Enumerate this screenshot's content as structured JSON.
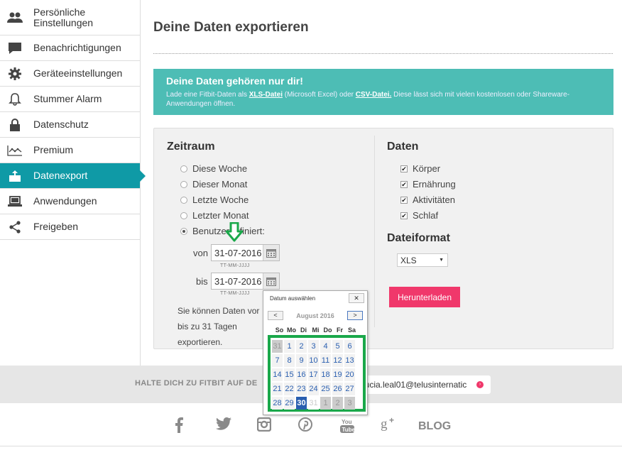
{
  "sidebar": {
    "items": [
      {
        "label": "Persönliche Einstellungen",
        "icon": "users-icon"
      },
      {
        "label": "Benachrichtigungen",
        "icon": "chat-bubble-icon"
      },
      {
        "label": "Geräteeinstellungen",
        "icon": "gear-icon"
      },
      {
        "label": "Stummer Alarm",
        "icon": "bell-icon"
      },
      {
        "label": "Datenschutz",
        "icon": "lock-icon"
      },
      {
        "label": "Premium",
        "icon": "chart-line-icon"
      },
      {
        "label": "Datenexport",
        "icon": "export-icon",
        "active": true
      },
      {
        "label": "Anwendungen",
        "icon": "laptop-icon"
      },
      {
        "label": "Freigeben",
        "icon": "share-icon"
      }
    ]
  },
  "page": {
    "title": "Deine Daten exportieren"
  },
  "banner": {
    "title": "Deine Daten gehören nur dir!",
    "text_before": "Lade eine Fitbit-Daten als ",
    "xls_link": "XLS-Datei",
    "text_middle": " (Microsoft Excel) oder ",
    "csv_link": "CSV-Datei.",
    "text_after": " Diese lässt sich mit vielen kostenlosen oder Shareware-Anwendungen öffnen."
  },
  "zeitraum": {
    "title": "Zeitraum",
    "options": [
      "Diese Woche",
      "Dieser Monat",
      "Letzte Woche",
      "Letzter Monat",
      "Benutzerdefiniert:"
    ],
    "selected_index": 4,
    "from_label": "von",
    "from_value": "31-07-2016",
    "to_label": "bis",
    "to_value": "31-07-2016",
    "date_hint": "TT-MM-JJJJ",
    "info_lines": [
      "Sie können Daten vor",
      "bis zu 31 Tagen",
      "exportieren."
    ]
  },
  "daten": {
    "title": "Daten",
    "options": [
      {
        "label": "Körper",
        "checked": true
      },
      {
        "label": "Ernährung",
        "checked": true
      },
      {
        "label": "Aktivitäten",
        "checked": true
      },
      {
        "label": "Schlaf",
        "checked": true
      }
    ]
  },
  "dateiformat": {
    "title": "Dateiformat",
    "selected": "XLS"
  },
  "download_button": "Herunterladen",
  "footer": {
    "text": "HALTE DICH ZU FITBIT AUF DE",
    "email": "lucia.leal01@telusinternatic",
    "blog": "BLOG",
    "social_icons": [
      "facebook-icon",
      "twitter-icon",
      "instagram-icon",
      "pinterest-icon",
      "youtube-icon",
      "google-plus-icon"
    ]
  },
  "datepicker": {
    "header": "Datum auswählen",
    "close": "✕",
    "prev": "<",
    "next": ">",
    "month": "August 2016",
    "weekdays": [
      "So",
      "Mo",
      "Di",
      "Mi",
      "Do",
      "Fr",
      "Sa"
    ],
    "weeks": [
      [
        {
          "d": "31",
          "s": "other"
        },
        {
          "d": "1",
          "s": "normal"
        },
        {
          "d": "2",
          "s": "normal"
        },
        {
          "d": "3",
          "s": "normal"
        },
        {
          "d": "4",
          "s": "normal"
        },
        {
          "d": "5",
          "s": "normal"
        },
        {
          "d": "6",
          "s": "normal"
        }
      ],
      [
        {
          "d": "7",
          "s": "normal"
        },
        {
          "d": "8",
          "s": "normal"
        },
        {
          "d": "9",
          "s": "normal"
        },
        {
          "d": "10",
          "s": "normal"
        },
        {
          "d": "11",
          "s": "normal"
        },
        {
          "d": "12",
          "s": "normal"
        },
        {
          "d": "13",
          "s": "normal"
        }
      ],
      [
        {
          "d": "14",
          "s": "normal"
        },
        {
          "d": "15",
          "s": "normal"
        },
        {
          "d": "16",
          "s": "normal"
        },
        {
          "d": "17",
          "s": "normal"
        },
        {
          "d": "18",
          "s": "normal"
        },
        {
          "d": "19",
          "s": "normal"
        },
        {
          "d": "20",
          "s": "normal"
        }
      ],
      [
        {
          "d": "21",
          "s": "normal"
        },
        {
          "d": "22",
          "s": "normal"
        },
        {
          "d": "23",
          "s": "normal"
        },
        {
          "d": "24",
          "s": "normal"
        },
        {
          "d": "25",
          "s": "normal"
        },
        {
          "d": "26",
          "s": "normal"
        },
        {
          "d": "27",
          "s": "normal"
        }
      ],
      [
        {
          "d": "28",
          "s": "normal"
        },
        {
          "d": "29",
          "s": "normal"
        },
        {
          "d": "30",
          "s": "today"
        },
        {
          "d": "31",
          "s": "disabled"
        },
        {
          "d": "1",
          "s": "other"
        },
        {
          "d": "2",
          "s": "other"
        },
        {
          "d": "3",
          "s": "other"
        }
      ]
    ]
  },
  "colors": {
    "accent": "#0f9aa6",
    "banner": "#4dbdb5",
    "button": "#f0386b",
    "highlight": "#1aa84a"
  }
}
